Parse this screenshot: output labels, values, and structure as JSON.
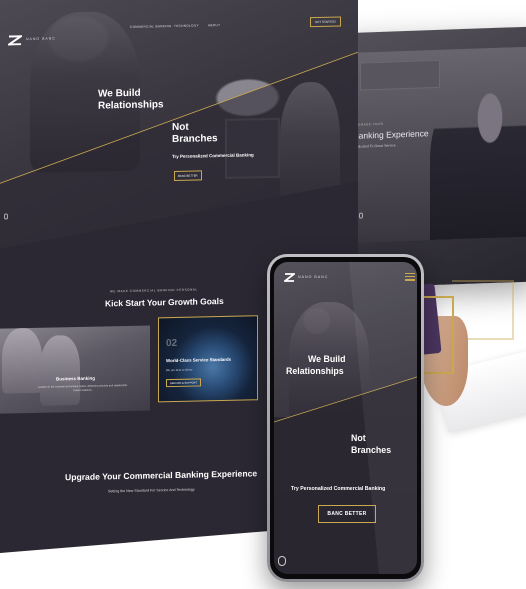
{
  "brand": {
    "name": "NANO BANC",
    "accent": "#c9a84f"
  },
  "desktop": {
    "nav": {
      "links": [
        "COMMERCIAL BANKING",
        "TECHNOLOGY",
        "ABOUT"
      ],
      "cta": "GET STARTED"
    },
    "hero": {
      "line1": "We Build",
      "line2": "Relationships",
      "line3": "Not",
      "line4": "Branches",
      "subtitle": "Try Personalized Commercial Banking",
      "button": "BANC BETTER"
    },
    "kick": {
      "eyebrow": "WE MAKE COMMERCIAL BANKING PERSONAL",
      "title": "Kick Start Your Growth Goals"
    },
    "cards": {
      "business": {
        "title": "Business Banking",
        "text": "Leaders in the commercial banking space, delivering security and relationship-based solutions."
      },
      "world": {
        "number": "02",
        "title": "World-Class Service Standards",
        "text": "We are here to Serve",
        "button": "SERVICE & SUPPORT"
      }
    },
    "upgrade": {
      "title": "Upgrade Your Commercial Banking Experience",
      "subtitle": "Setting the New Standard For Service And Technology"
    }
  },
  "back_screen": {
    "eyebrow": "UPGRADE YOUR",
    "title": "Banking Experience",
    "subtitle": "Dedicated To Great Service"
  },
  "phone": {
    "brand": "NANO BANC",
    "hero": {
      "line1": "We Build",
      "line2": "Relationships",
      "line3": "Not",
      "line4": "Branches",
      "subtitle": "Try Personalized Commercial Banking",
      "button": "BANC BETTER"
    }
  }
}
